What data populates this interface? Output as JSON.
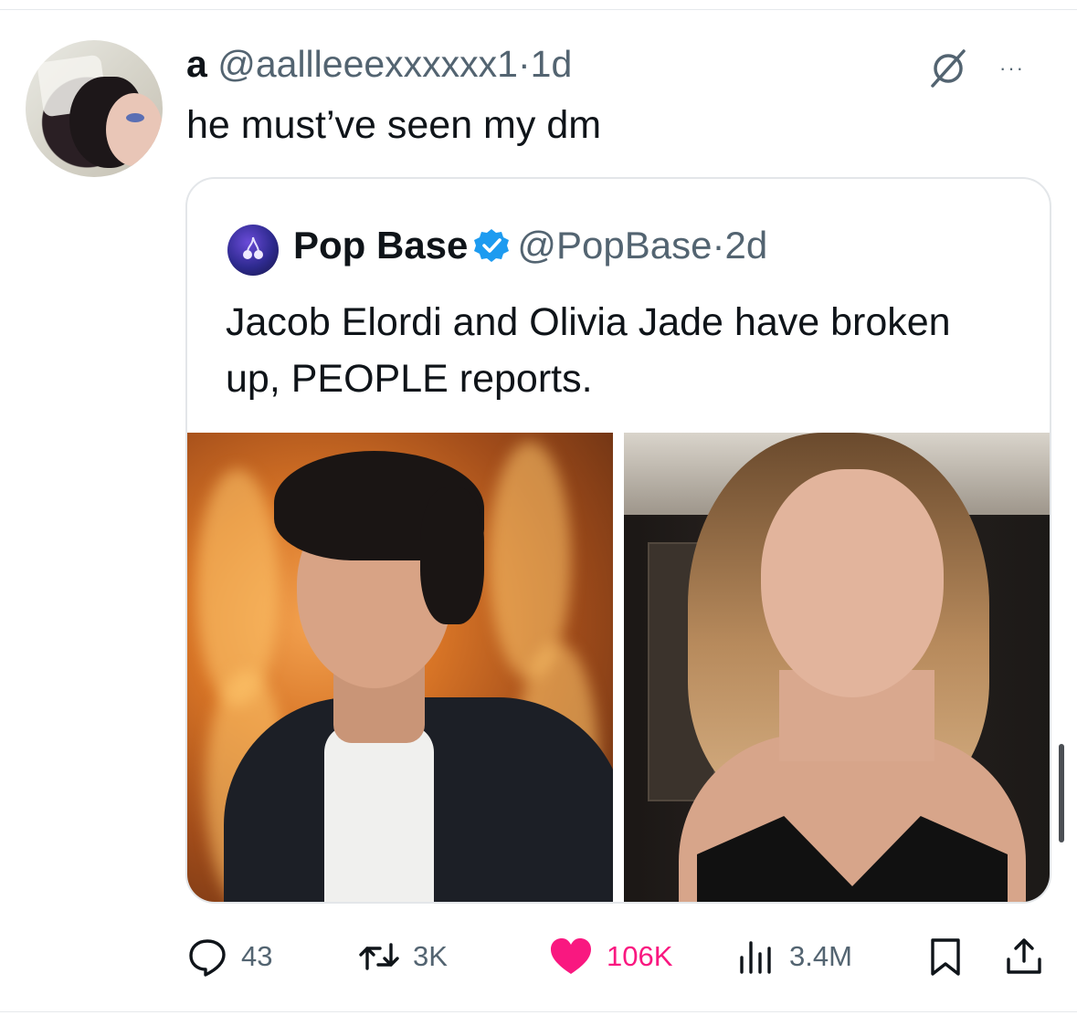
{
  "tweet": {
    "display_name": "a",
    "handle": "@aallleeexxxxxx1",
    "separator": "·",
    "time": "1d",
    "text": "he must’ve seen my dm"
  },
  "header_icons": [
    "grok-icon",
    "more-icon"
  ],
  "more_label": "···",
  "quoted": {
    "display_name": "Pop Base",
    "verified": true,
    "handle": "@PopBase",
    "separator": "·",
    "time": "2d",
    "text": "Jacob Elordi and Olivia Jade have broken up, PEOPLE reports.",
    "images": [
      "man-in-black-denim-jacket-photo",
      "woman-with-wavy-hair-photo"
    ]
  },
  "actions": {
    "replies": "43",
    "retweets": "3K",
    "likes": "106K",
    "views": "3.4M",
    "liked": true
  },
  "colors": {
    "text": "#0f1419",
    "secondary": "#536471",
    "like": "#f91880",
    "verified": "#1d9bf0"
  }
}
